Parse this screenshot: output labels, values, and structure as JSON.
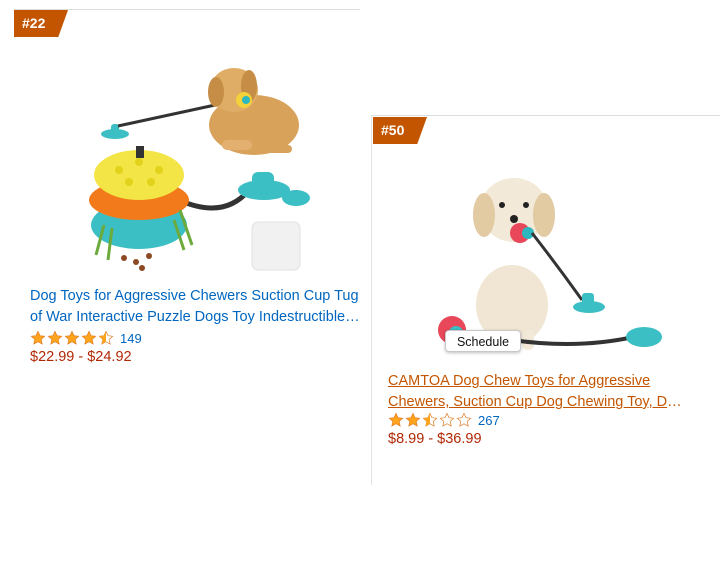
{
  "colors": {
    "badge": "#c45500",
    "link": "#0066c0",
    "visited_link": "#c45500",
    "price": "#b12704",
    "star": "#ffa41c"
  },
  "products": [
    {
      "rank": "#22",
      "title": "Dog Toys for Aggressive Chewers Suction Cup Tug of War Interactive Puzzle Dogs Toy Indestructible…",
      "rating": 4.5,
      "rating_count": "149",
      "price": "$22.99 - $24.92",
      "image": "golden-retriever-with-suction-cup-tug-toy-and-puzzle-ball"
    },
    {
      "rank": "#50",
      "title": "CAMTOA Dog Chew Toys for Aggressive Chewers, Suction Cup Dog Chewing Toy, Dog Rope Ball…",
      "rating": 2.5,
      "rating_count": "267",
      "price": "$8.99 - $36.99",
      "image": "puppy-with-suction-cup-rope-ball-toy",
      "overlay_button": "Schedule"
    }
  ]
}
